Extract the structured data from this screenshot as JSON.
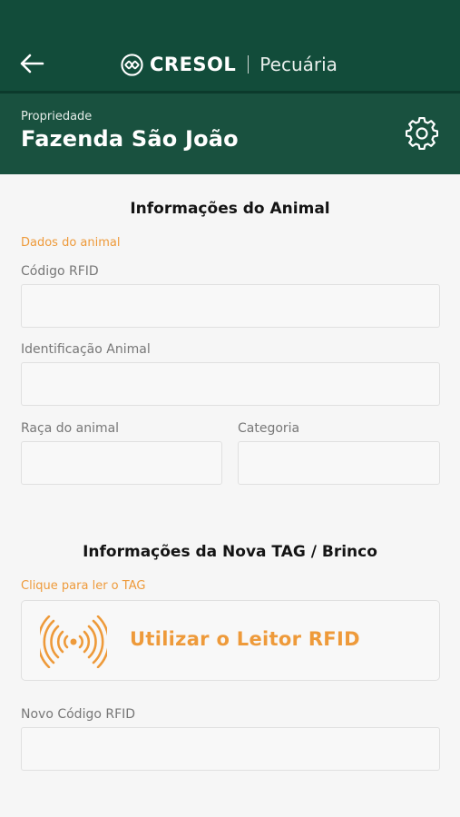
{
  "header": {
    "brand_name": "CRESOL",
    "product_name": "Pecuária"
  },
  "property": {
    "label": "Propriedade",
    "name": "Fazenda São João"
  },
  "animal_info": {
    "title": "Informações do Animal",
    "subtitle": "Dados do animal",
    "rfid_label": "Código RFID",
    "rfid_value": "",
    "id_label": "Identificação Animal",
    "id_value": "",
    "breed_label": "Raça do animal",
    "breed_value": "",
    "category_label": "Categoria",
    "category_value": ""
  },
  "tag_info": {
    "title": "Informações da Nova TAG / Brinco",
    "subtitle": "Clique para ler o TAG",
    "reader_button_label": "Utilizar o Leitor RFID",
    "new_rfid_label": "Novo Código RFID",
    "new_rfid_value": ""
  },
  "colors": {
    "header_bg": "#124c3a",
    "accent": "#ee9a3a",
    "page_bg": "#f6f6f6"
  },
  "icons": {
    "back": "arrow-left-icon",
    "brand": "cresol-logo-icon",
    "settings": "gear-icon",
    "rfid": "rfid-signal-icon"
  }
}
